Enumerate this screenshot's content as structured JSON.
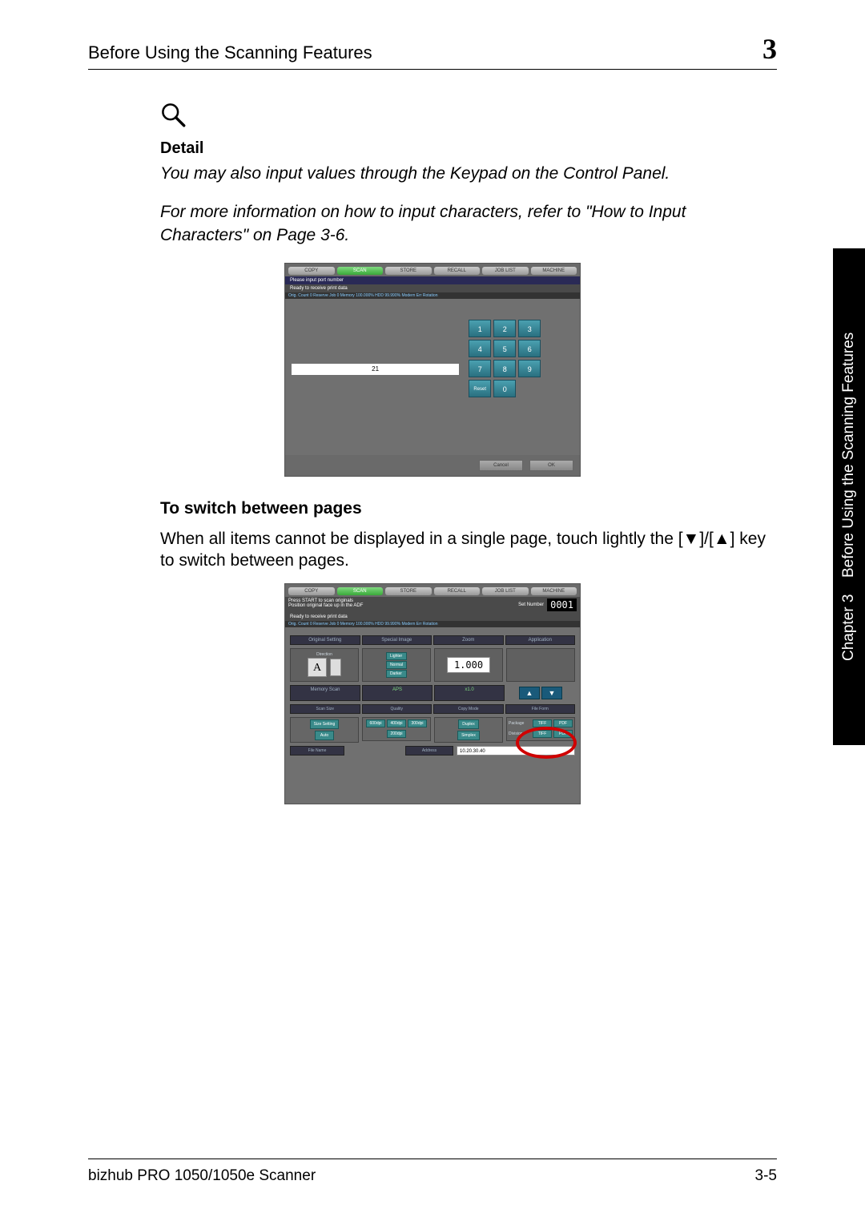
{
  "header": {
    "title": "Before Using the Scanning Features",
    "chapter_number": "3"
  },
  "detail": {
    "heading": "Detail",
    "line1": "You may also input values through the Keypad on the Control Panel.",
    "line2": "For more information on how to input characters, refer to \"How to Input Characters\" on Page 3-6."
  },
  "screenshot1": {
    "tabs": [
      "COPY",
      "SCAN",
      "STORE",
      "RECALL",
      "JOB LIST",
      "MACHINE"
    ],
    "active_tab_index": 1,
    "msg": "Please input port number",
    "status": "Ready to receive print data",
    "meter": "Orig. Count   0 Reserve Job   0 Memory  100.000% HDD       99.990%  Modern Err  Rotation",
    "input_value": "21",
    "keypad": [
      "1",
      "2",
      "3",
      "4",
      "5",
      "6",
      "7",
      "8",
      "9",
      "Reset",
      "0",
      ""
    ],
    "buttons": {
      "cancel": "Cancel",
      "ok": "OK"
    }
  },
  "section": {
    "heading": "To switch between pages",
    "paragraph": "When all items cannot be displayed in a single page, touch lightly the [▼]/[▲] key to switch between pages."
  },
  "screenshot2": {
    "tabs": [
      "COPY",
      "SCAN",
      "STORE",
      "RECALL",
      "JOB LIST",
      "MACHINE"
    ],
    "active_tab_index": 1,
    "msg1": "Press START to scan originals",
    "msg2": "Position original face up in the ADF",
    "set_label": "Set Number",
    "set_value": "0001",
    "status": "Ready to receive print data",
    "meter": "Orig. Count   0 Reserve Job   0 Memory  100.000% HDD       99.990%  Modern Err  Rotation",
    "row_tabs": [
      "Original Setting",
      "Special Image",
      "Zoom",
      "Application"
    ],
    "direction_label": "Direction",
    "direction_value": "A",
    "density": [
      "Lighter",
      "Normal",
      "Darker"
    ],
    "zoom_value": "1.000",
    "memory_scan": "Memory Scan",
    "aps": "APS",
    "x1": "x1.0",
    "arrows": [
      "▲",
      "▼"
    ],
    "row2": [
      "Scan Size",
      "Quality",
      "Copy Mode",
      "File Form"
    ],
    "col1": {
      "a": "Size Setting",
      "b": "Auto"
    },
    "col2": [
      "600dpi",
      "400dpi",
      "300dpi",
      "200dpi"
    ],
    "col3": [
      "Duplex",
      "Simplex"
    ],
    "col4_labels": [
      "Package",
      "Division"
    ],
    "col4_options": [
      "TIFF",
      "PDF",
      "TIFF",
      "PDF"
    ],
    "filename_label": "File Name",
    "address_label": "Address",
    "address_value": "10.20.30.40"
  },
  "sidebar": {
    "text": "Before Using the Scanning Features",
    "chapter": "Chapter 3"
  },
  "footer": {
    "product": "bizhub PRO 1050/1050e Scanner",
    "page": "3-5"
  }
}
